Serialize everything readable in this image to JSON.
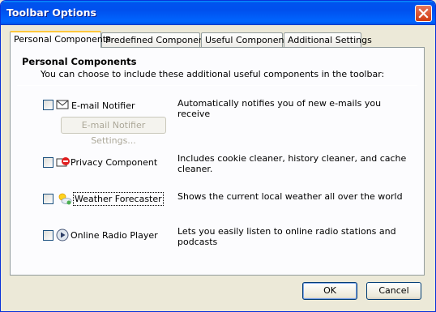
{
  "window": {
    "title": "Toolbar Options"
  },
  "tabs": [
    {
      "label": "Personal Components"
    },
    {
      "label": "Predefined Components"
    },
    {
      "label": "Useful Components"
    },
    {
      "label": "Additional Settings"
    }
  ],
  "panel": {
    "heading": "Personal Components",
    "subheading": "You can choose to include these additional useful components in the toolbar:"
  },
  "components": [
    {
      "label": "E-mail Notifier",
      "description": "Automatically notifies you of new e-mails you receive",
      "checked": false,
      "icon": "email-notifier-icon"
    },
    {
      "label": "Privacy Component",
      "description": "Includes cookie cleaner, history cleaner, and cache cleaner.",
      "checked": false,
      "icon": "privacy-icon"
    },
    {
      "label": "Weather Forecaster",
      "description": "Shows the current local weather all over the world",
      "checked": false,
      "icon": "weather-icon"
    },
    {
      "label": "Online Radio Player",
      "description": "Lets you easily listen to online radio stations and podcasts",
      "checked": false,
      "icon": "radio-play-icon"
    }
  ],
  "email_settings_button": "E-mail Notifier Settings...",
  "buttons": {
    "ok": "OK",
    "cancel": "Cancel"
  }
}
